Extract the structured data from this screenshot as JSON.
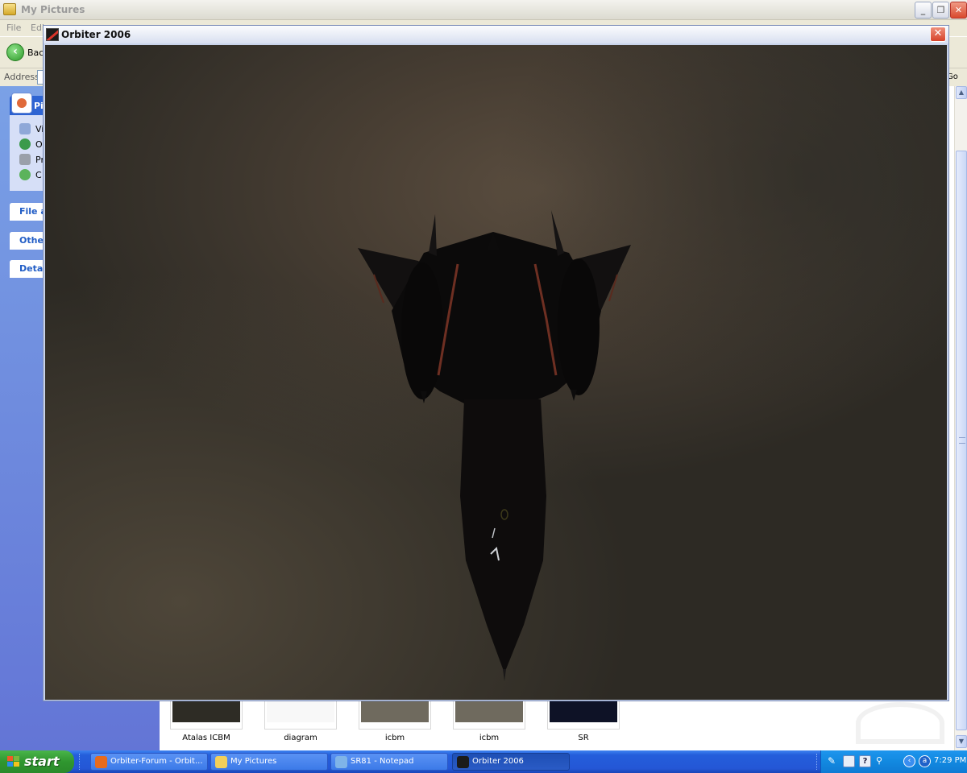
{
  "explorer": {
    "title": "My Pictures",
    "menu": [
      "File",
      "Edi"
    ],
    "back_label": "Back",
    "address_label": "Address",
    "go_label": "Go",
    "tasks": {
      "pictures_head": "Pi",
      "pictures_items": [
        "Vi",
        "O",
        "Pr",
        "C"
      ],
      "file_head": "File ar",
      "other_head": "Other",
      "details_head": "Detai"
    },
    "thumbnails": [
      {
        "label": "Atalas ICBM",
        "color": "#2e2c25"
      },
      {
        "label": "diagram",
        "color": "#f8f8f8"
      },
      {
        "label": "icbm",
        "color": "#6f6a5e"
      },
      {
        "label": "icbm",
        "color": "#6f6a5e"
      },
      {
        "label": "SR",
        "color": "#0e1226"
      }
    ]
  },
  "orbiter": {
    "title": "Orbiter 2006",
    "close_label": "✕"
  },
  "taskbar": {
    "start_label": "start",
    "buttons": [
      {
        "label": "Orbiter-Forum - Orbit...",
        "icon": "firefox-icon",
        "color": "#e66b1d",
        "active": false
      },
      {
        "label": "My Pictures",
        "icon": "folder-icon",
        "color": "#f2cf5a",
        "active": false
      },
      {
        "label": "SR81 - Notepad",
        "icon": "notepad-icon",
        "color": "#7fb4e8",
        "active": false
      },
      {
        "label": "Orbiter 2006",
        "icon": "orbiter-icon",
        "color": "#1b1b1b",
        "active": true
      }
    ],
    "clock": "7:29 PM"
  }
}
